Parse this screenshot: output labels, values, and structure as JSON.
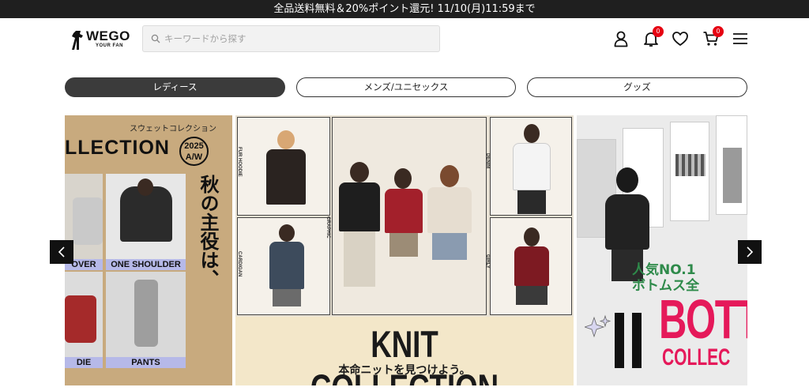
{
  "announcement": "全品送料無料＆20%ポイント還元! 11/10(月)11:59まで",
  "logo": {
    "name": "WEGO",
    "tagline": "YOUR FAN"
  },
  "search": {
    "placeholder": "キーワードから探す",
    "value": ""
  },
  "header_icons": {
    "notifications_badge": "0",
    "cart_badge": "0"
  },
  "categories": [
    {
      "label": "レディース",
      "active": true
    },
    {
      "label": "メンズ/ユニセックス",
      "active": false
    },
    {
      "label": "グッズ",
      "active": false
    }
  ],
  "banners": {
    "sweat": {
      "subtitle": "スウェットコレクション",
      "title": "LLECTION",
      "season": "2025",
      "season2": "A/W",
      "tagline": "秋の主役は、",
      "labels": [
        "OVER",
        "ONE SHOULDER",
        "DIE",
        "PANTS"
      ]
    },
    "knit": {
      "title": "KNIT COLLECTION",
      "subtitle": "本命ニットを見つけよう。",
      "side_labels": [
        "FUR HOODIE",
        "GRAPHIC",
        "CARDIGAN",
        "DENIM",
        "GIRLY"
      ]
    },
    "bottoms": {
      "line1": "人気NO.1",
      "line2": "ボトムス全",
      "title": "BOTT",
      "sub": "COLLEC"
    }
  },
  "colors": {
    "topbar": "#1f1f1f",
    "badge": "#e60012",
    "active_tab": "#3b3b3b",
    "sweat_bg": "#c8aa7e",
    "label_purple": "#b6b9e8",
    "bottoms_pink": "#e5195a"
  }
}
